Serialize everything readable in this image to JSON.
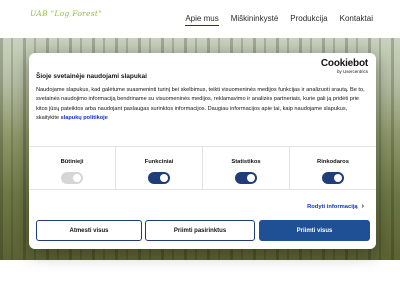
{
  "site": {
    "logo": "UAB \"Log Forest\"",
    "nav": [
      {
        "label": "Apie mus",
        "active": true
      },
      {
        "label": "Miškininkystė",
        "active": false
      },
      {
        "label": "Produkcija",
        "active": false
      },
      {
        "label": "Kontaktai",
        "active": false
      }
    ]
  },
  "cookie_dialog": {
    "brand": "Cookiebot",
    "brand_sub": "by Usercentrics",
    "title": "Šioje svetainėje naudojami slapukai",
    "body": "Naudojame slapukus, kad galėtume suasmeninti turinį bei skelbimus, teikti visuomeninės medijos funkcijas ir analizuoti srautą. Be to, svetainės naudojimo informaciją bendriname su visuomeninės medijos, reklamavimo ir analizės partneriais, kurie gali ją pridėti prie kitos jūsų pateiktos arba naudojant paslaugas surinktos informacijos. Daugiau informacijos apie tai, kaip naudojame slapukus, skaitykite",
    "policy_link": "slapukų politikoje",
    "toggles": [
      {
        "label": "Būtinieji",
        "enabled": true,
        "locked": true
      },
      {
        "label": "Funkciniai",
        "enabled": true,
        "locked": false
      },
      {
        "label": "Statistikos",
        "enabled": true,
        "locked": false
      },
      {
        "label": "Rinkodaros",
        "enabled": true,
        "locked": false
      }
    ],
    "details_label": "Rodyti informaciją",
    "buttons": {
      "deny": "Atmesti visus",
      "selection": "Priimti pasirinktus",
      "accept_all": "Priimti visus"
    },
    "colors": {
      "accent": "#1f5096",
      "toggle_on": "#1f3d7a",
      "toggle_locked": "#d6d6d6",
      "link": "#1032cf"
    }
  }
}
